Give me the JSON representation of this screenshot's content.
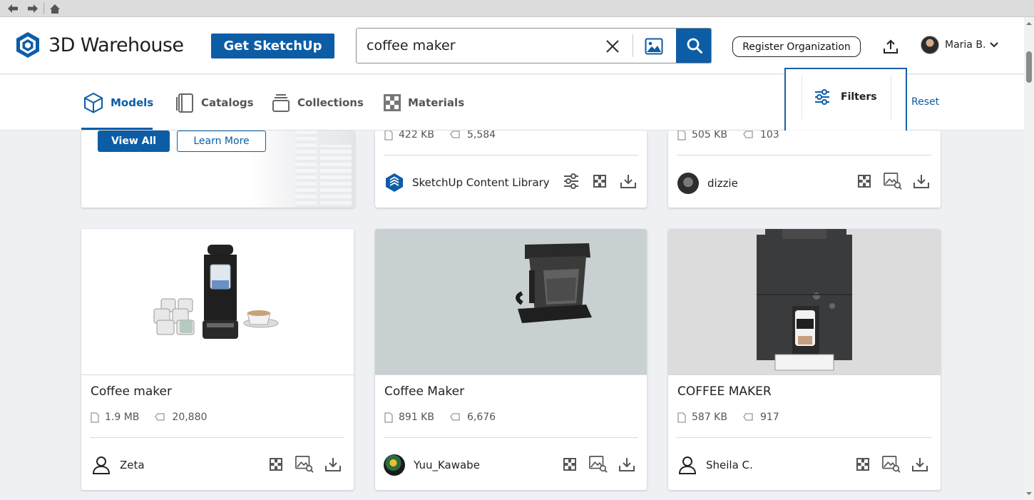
{
  "browser": {
    "back_label": "back",
    "forward_label": "forward",
    "home_label": "home"
  },
  "header": {
    "logo_text": "3D Warehouse",
    "get_sketchup_label": "Get SketchUp",
    "search_value": "coffee maker",
    "register_label": "Register Organization",
    "user_name": "Maria B."
  },
  "tabs": [
    {
      "label": "Models",
      "icon": "cube-icon",
      "active": true
    },
    {
      "label": "Catalogs",
      "icon": "catalog-icon",
      "active": false
    },
    {
      "label": "Collections",
      "icon": "collections-icon",
      "active": false
    },
    {
      "label": "Materials",
      "icon": "materials-icon",
      "active": false
    }
  ],
  "filters": {
    "label": "Filters",
    "reset_label": "Reset"
  },
  "promo": {
    "view_all_label": "View All",
    "learn_more_label": "Learn More"
  },
  "top_cards": [
    {
      "size": "422 KB",
      "downloads": "5,584",
      "owner": "SketchUp Content Library"
    },
    {
      "size": "505 KB",
      "downloads": "103",
      "owner": "dizzie"
    }
  ],
  "cards": [
    {
      "title": "Coffee maker",
      "size": "1.9 MB",
      "downloads": "20,880",
      "owner": "Zeta"
    },
    {
      "title": "Coffee Maker",
      "size": "891 KB",
      "downloads": "6,676",
      "owner": "Yuu_Kawabe"
    },
    {
      "title": "COFFEE MAKER",
      "size": "587 KB",
      "downloads": "917",
      "owner": "Sheila C."
    }
  ],
  "colors": {
    "accent": "#0c5da6",
    "page_bg": "#eef0f4",
    "filters_highlight": "#1a5ea8"
  }
}
